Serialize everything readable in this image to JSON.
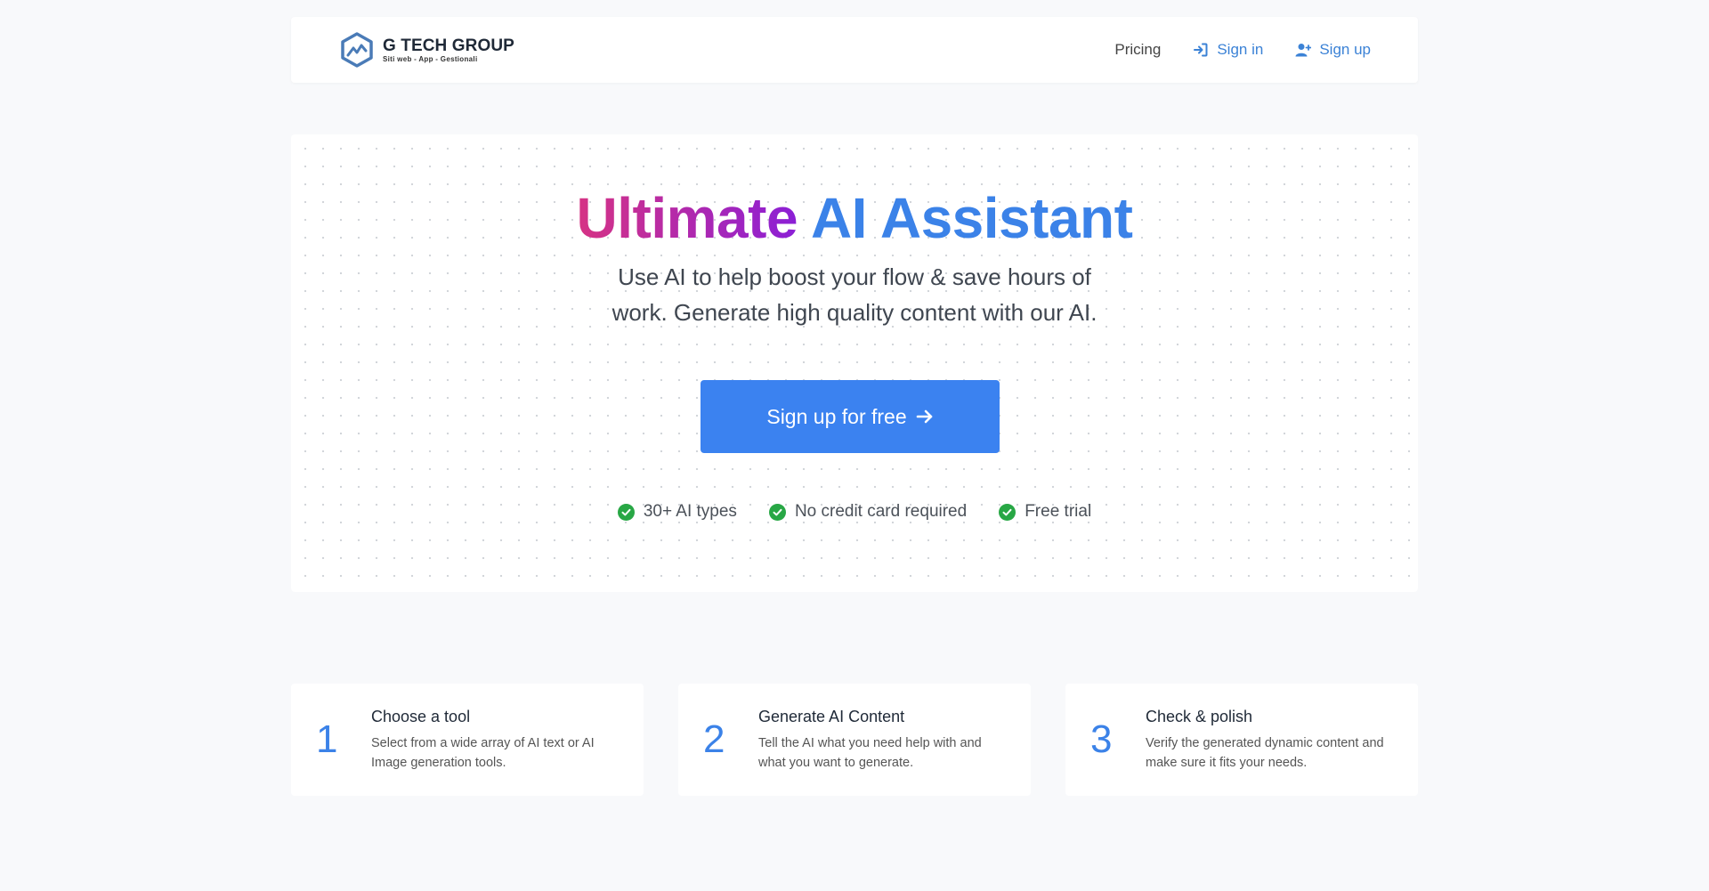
{
  "brand": {
    "name": "G TECH GROUP",
    "tagline": "Siti web - App - Gestionali"
  },
  "nav": {
    "pricing": "Pricing",
    "signin": "Sign in",
    "signup": "Sign up"
  },
  "hero": {
    "title_part1": "Ultimate",
    "title_part2": "AI Assistant",
    "subtitle_line1": "Use AI to help boost your flow & save hours of",
    "subtitle_line2": "work. Generate high quality content with our AI.",
    "cta_label": "Sign up for free",
    "features": [
      "30+ AI types",
      "No credit card required",
      "Free trial"
    ]
  },
  "steps": [
    {
      "number": "1",
      "title": "Choose a tool",
      "desc_line1": "Select from a wide array of AI text or AI",
      "desc_line2": "Image generation tools."
    },
    {
      "number": "2",
      "title": "Generate AI Content",
      "desc_line1": "Tell the AI what you need help with and",
      "desc_line2": "what you want to generate."
    },
    {
      "number": "3",
      "title": "Check & polish",
      "desc_line1": "Verify the generated dynamic content and",
      "desc_line2": "make sure it fits your needs."
    }
  ],
  "icons": {
    "logo": "g-tech-hexagon-logo",
    "signin": "sign-in-arrow-icon",
    "signup": "user-plus-icon",
    "cta_arrow": "arrow-right-icon",
    "feature_check": "check-circle-icon"
  },
  "colors": {
    "accent": "#3b82f0",
    "title_gradient_start": "#d63384",
    "title_gradient_end": "#8b1fd6",
    "check_green": "#28a745"
  }
}
